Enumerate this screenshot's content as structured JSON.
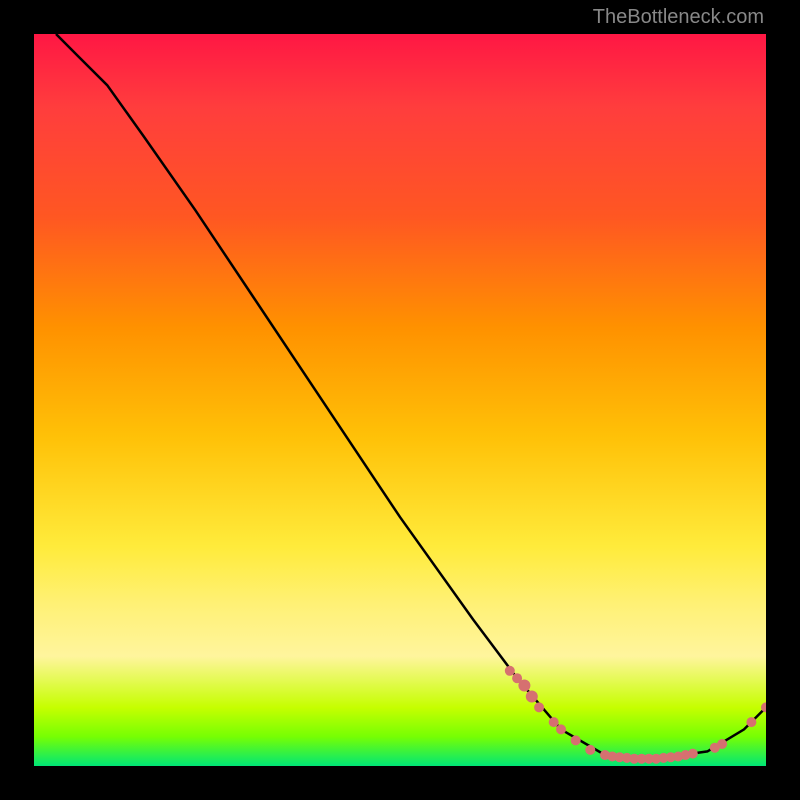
{
  "watermark": "TheBottleneck.com",
  "chart_data": {
    "type": "line",
    "title": "",
    "xlabel": "",
    "ylabel": "",
    "xlim": [
      0,
      100
    ],
    "ylim": [
      0,
      100
    ],
    "curve": {
      "name": "bottleneck-curve",
      "points": [
        {
          "x": 3,
          "y": 100
        },
        {
          "x": 6,
          "y": 97
        },
        {
          "x": 10,
          "y": 93
        },
        {
          "x": 15,
          "y": 86
        },
        {
          "x": 22,
          "y": 76
        },
        {
          "x": 30,
          "y": 64
        },
        {
          "x": 40,
          "y": 49
        },
        {
          "x": 50,
          "y": 34
        },
        {
          "x": 60,
          "y": 20
        },
        {
          "x": 66,
          "y": 12
        },
        {
          "x": 72,
          "y": 5
        },
        {
          "x": 78,
          "y": 1.5
        },
        {
          "x": 85,
          "y": 1
        },
        {
          "x": 92,
          "y": 2
        },
        {
          "x": 97,
          "y": 5
        },
        {
          "x": 100,
          "y": 8
        }
      ]
    },
    "markers": [
      {
        "x": 65,
        "y": 13,
        "r": 5
      },
      {
        "x": 66,
        "y": 12,
        "r": 5
      },
      {
        "x": 67,
        "y": 11,
        "r": 6
      },
      {
        "x": 68,
        "y": 9.5,
        "r": 6
      },
      {
        "x": 69,
        "y": 8,
        "r": 5
      },
      {
        "x": 71,
        "y": 6,
        "r": 5
      },
      {
        "x": 72,
        "y": 5,
        "r": 5
      },
      {
        "x": 74,
        "y": 3.5,
        "r": 5
      },
      {
        "x": 76,
        "y": 2.2,
        "r": 5
      },
      {
        "x": 78,
        "y": 1.5,
        "r": 5
      },
      {
        "x": 79,
        "y": 1.3,
        "r": 5
      },
      {
        "x": 80,
        "y": 1.2,
        "r": 5
      },
      {
        "x": 81,
        "y": 1.1,
        "r": 5
      },
      {
        "x": 82,
        "y": 1.0,
        "r": 5
      },
      {
        "x": 83,
        "y": 1.0,
        "r": 5
      },
      {
        "x": 84,
        "y": 1.0,
        "r": 5
      },
      {
        "x": 85,
        "y": 1.0,
        "r": 5
      },
      {
        "x": 86,
        "y": 1.1,
        "r": 5
      },
      {
        "x": 87,
        "y": 1.2,
        "r": 5
      },
      {
        "x": 88,
        "y": 1.3,
        "r": 5
      },
      {
        "x": 89,
        "y": 1.5,
        "r": 5
      },
      {
        "x": 90,
        "y": 1.7,
        "r": 5
      },
      {
        "x": 93,
        "y": 2.5,
        "r": 5
      },
      {
        "x": 94,
        "y": 3,
        "r": 5
      },
      {
        "x": 98,
        "y": 6,
        "r": 5
      },
      {
        "x": 100,
        "y": 8,
        "r": 5
      }
    ],
    "colors": {
      "curve": "#000000",
      "markers": "#d67070"
    }
  }
}
